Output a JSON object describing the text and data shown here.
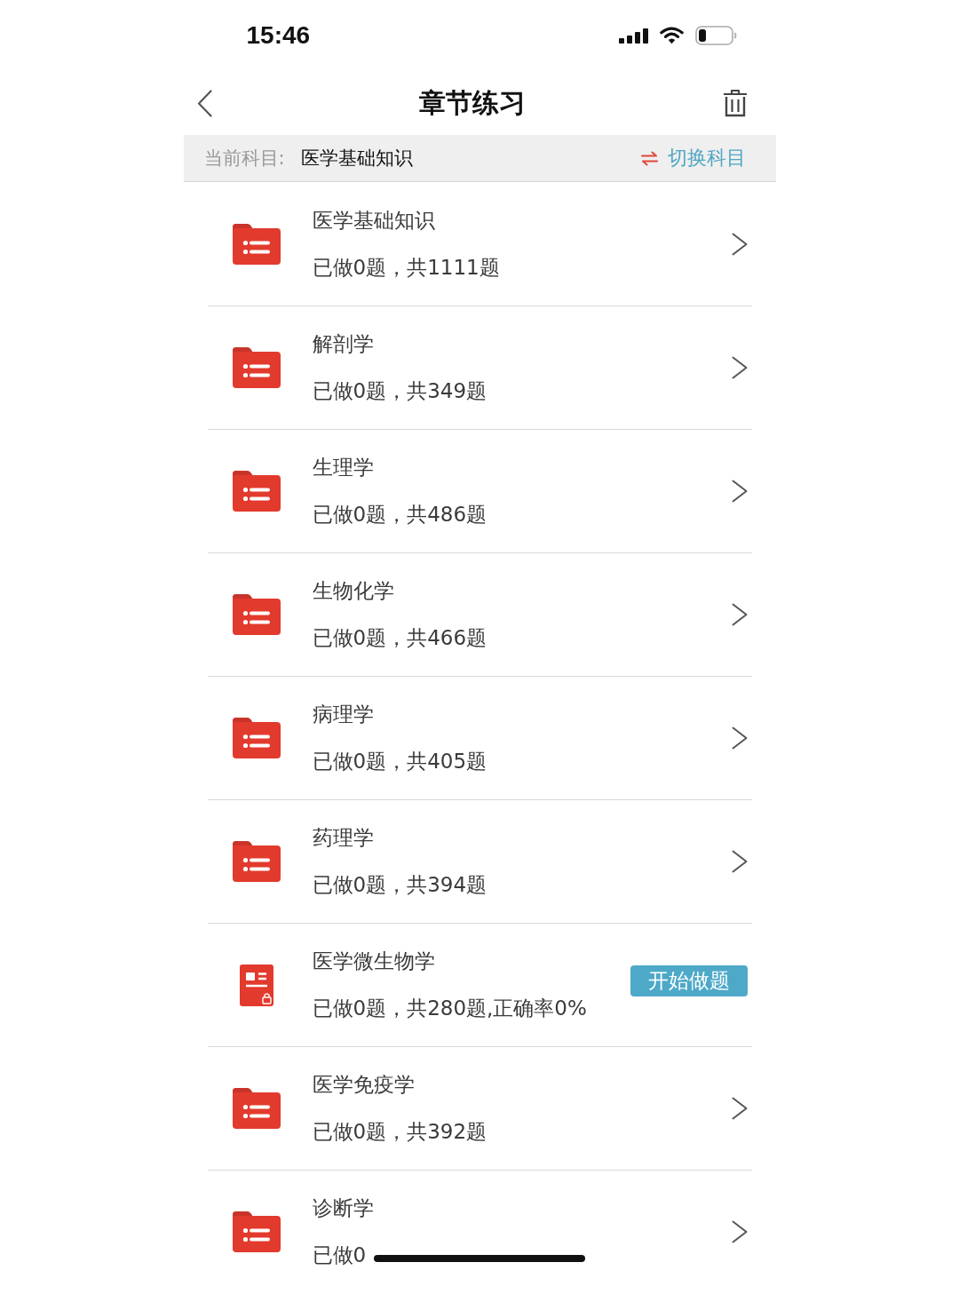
{
  "status_bar": {
    "time": "15:46"
  },
  "nav_bar": {
    "title": "章节练习"
  },
  "subject_bar": {
    "label": "当前科目:",
    "subject": "医学基础知识",
    "switch_label": "切换科目"
  },
  "chapters": [
    {
      "kind": "folder",
      "title": "医学基础知识",
      "summary": "已做0题，共1111题"
    },
    {
      "kind": "folder",
      "title": "解剖学",
      "summary": "已做0题，共349题"
    },
    {
      "kind": "folder",
      "title": "生理学",
      "summary": "已做0题，共486题"
    },
    {
      "kind": "folder",
      "title": "生物化学",
      "summary": "已做0题，共466题"
    },
    {
      "kind": "folder",
      "title": "病理学",
      "summary": "已做0题，共405题"
    },
    {
      "kind": "folder",
      "title": "药理学",
      "summary": "已做0题，共394题"
    },
    {
      "kind": "quiz",
      "title": "医学微生物学",
      "summary": "已做0题，共280题,正确率0%",
      "action": "开始做题"
    },
    {
      "kind": "folder",
      "title": "医学免疫学",
      "summary": "已做0题，共392题"
    },
    {
      "kind": "folder",
      "title": "诊断学",
      "summary": "已做0"
    }
  ]
}
